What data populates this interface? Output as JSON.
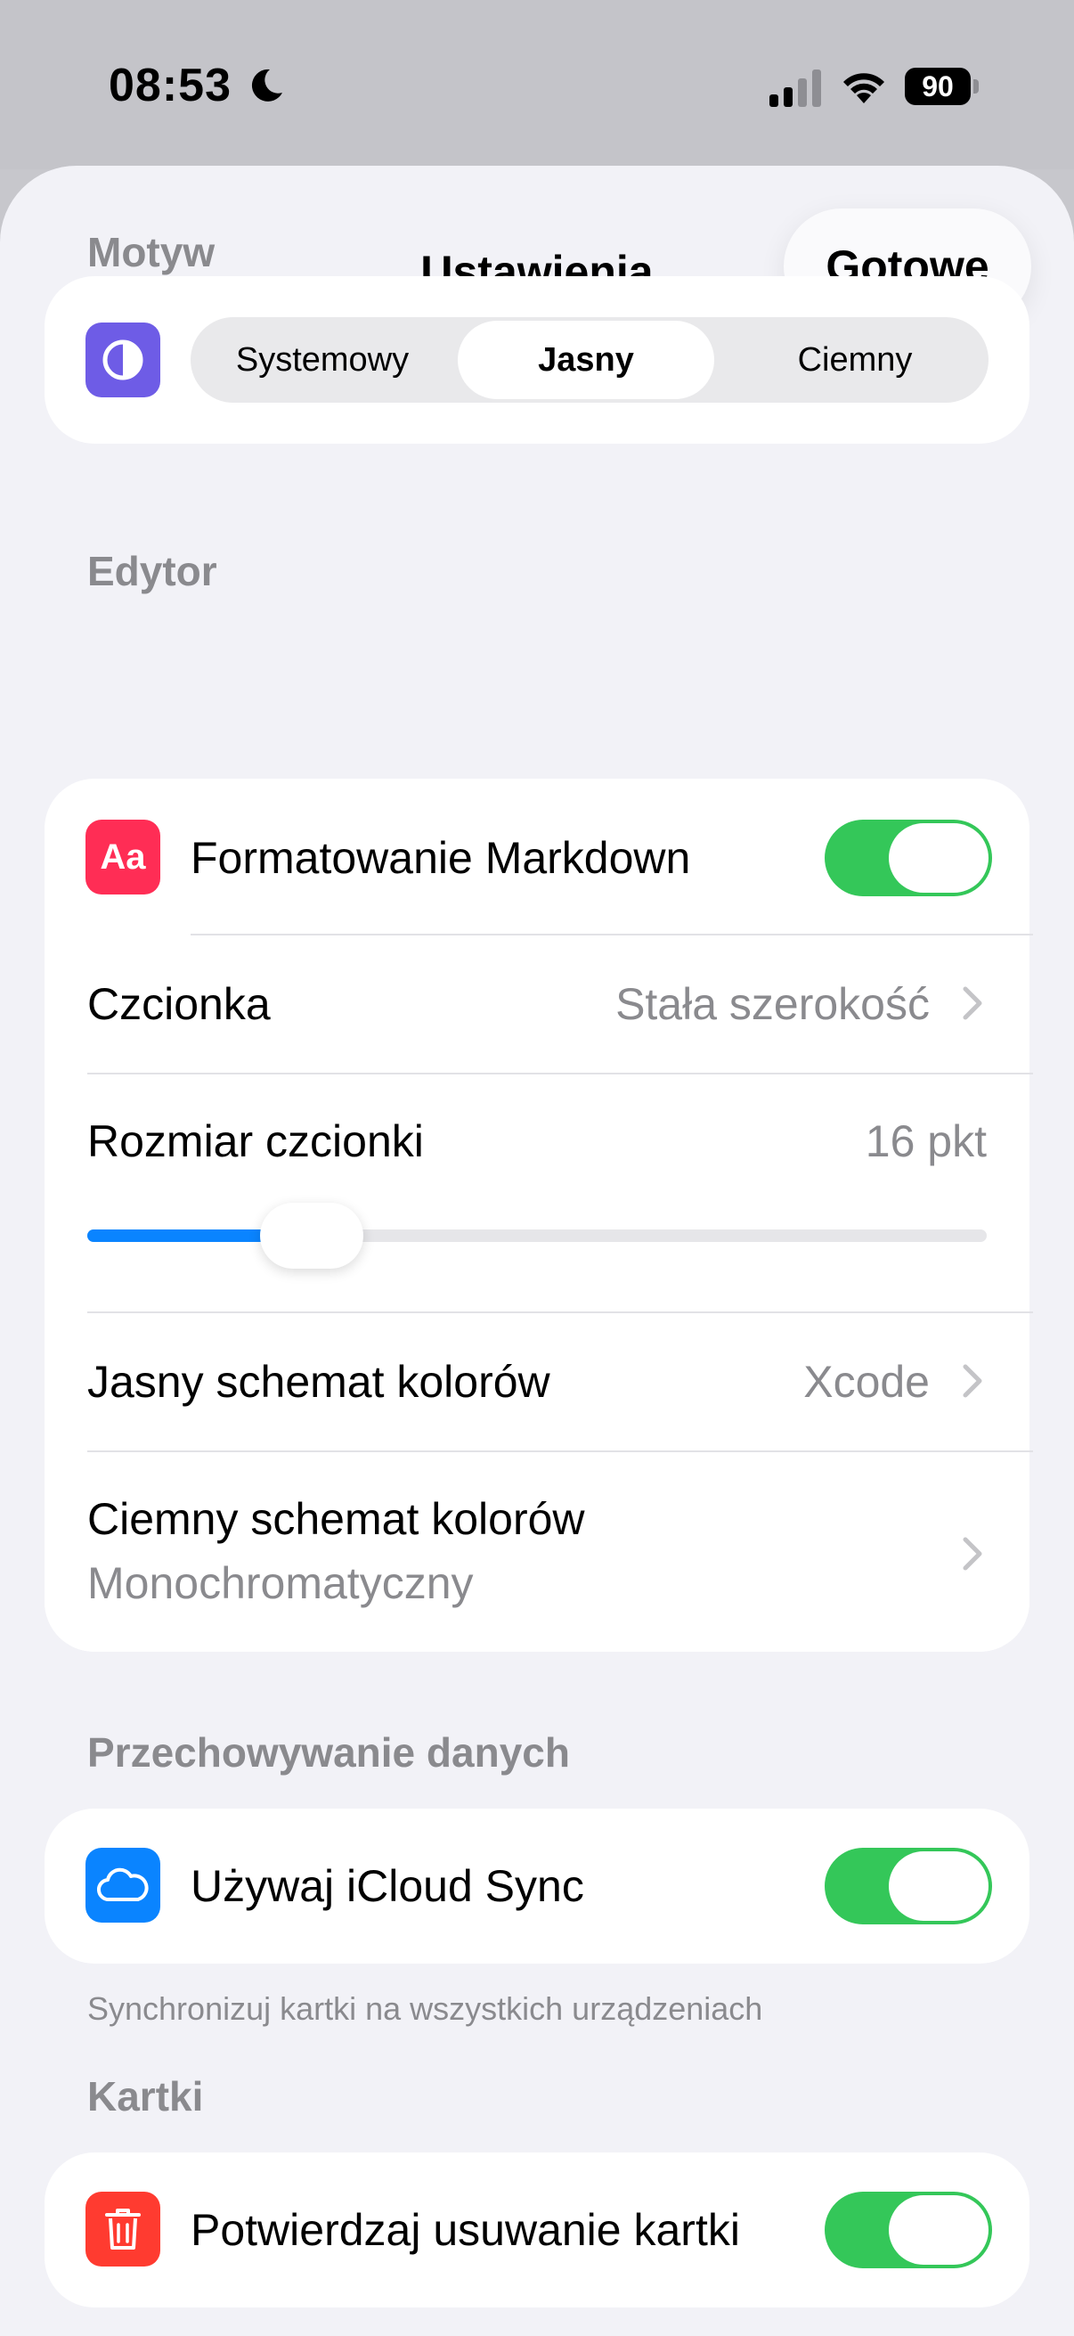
{
  "status_bar": {
    "time": "08:53",
    "battery": "90",
    "icons": [
      "moon-icon",
      "cellular-signal-icon",
      "wifi-icon",
      "battery-icon"
    ]
  },
  "nav": {
    "title": "Ustawienia",
    "done_label": "Gotowe"
  },
  "theme": {
    "header": "Motyw",
    "options": [
      "Systemowy",
      "Jasny",
      "Ciemny"
    ],
    "selected": "Jasny",
    "icon": "contrast-icon"
  },
  "editor": {
    "header": "Edytor",
    "markdown": {
      "label": "Formatowanie Markdown",
      "icon_text": "Aa",
      "on": true
    },
    "font": {
      "label": "Czcionka",
      "value": "Stała szerokość"
    },
    "font_size": {
      "label": "Rozmiar czcionki",
      "value": "16 pkt",
      "slider_fraction": 0.23
    },
    "light_scheme": {
      "label": "Jasny schemat kolorów",
      "value": "Xcode"
    },
    "dark_scheme": {
      "label": "Ciemny schemat kolorów",
      "value": "Monochromatyczny"
    }
  },
  "storage": {
    "header": "Przechowywanie danych",
    "icloud": {
      "label": "Używaj iCloud Sync",
      "on": true,
      "icon": "cloud-icon"
    },
    "note": "Synchronizuj kartki na wszystkich urządzeniach"
  },
  "cards": {
    "header": "Kartki",
    "confirm_delete": {
      "label": "Potwierdzaj usuwanie kartki",
      "on": true,
      "icon": "trash-icon"
    }
  },
  "colors": {
    "accent": "#0a84ff",
    "toggle_on": "#34c759",
    "theme_icon_bg": "#6e5ce6",
    "markdown_icon_bg": "#ff2d55",
    "icloud_icon_bg": "#0a84ff",
    "trash_icon_bg": "#ff3b30"
  }
}
